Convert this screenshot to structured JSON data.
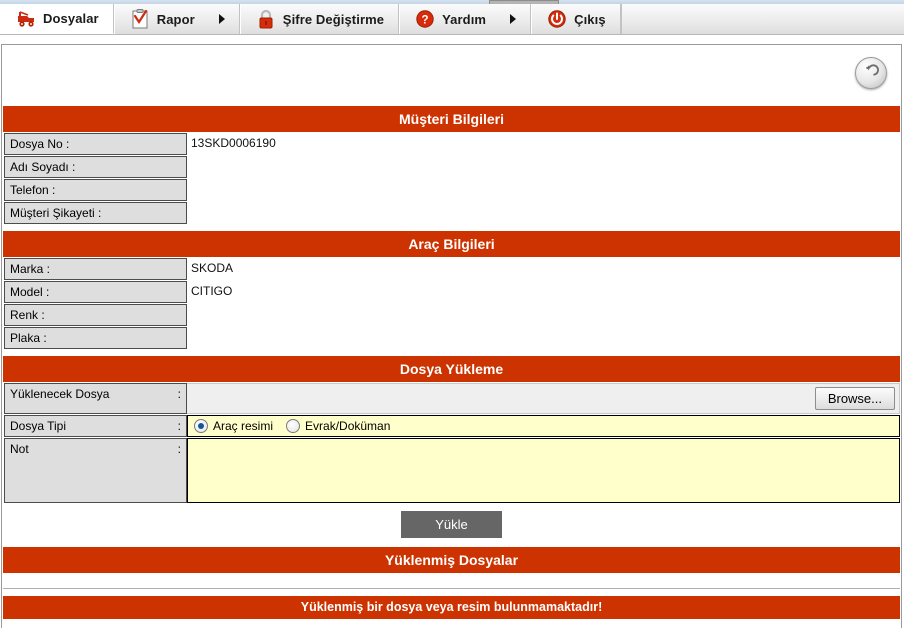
{
  "menu": {
    "items": [
      {
        "label": "Dosyalar",
        "icon": "tow-truck-icon",
        "active": true,
        "has_arrow": false
      },
      {
        "label": "Rapor",
        "icon": "clipboard-check-icon",
        "active": false,
        "has_arrow": true
      },
      {
        "label": "Şifre Değiştirme",
        "icon": "padlock-icon",
        "active": false,
        "has_arrow": false
      },
      {
        "label": "Yardım",
        "icon": "question-circle-icon",
        "active": false,
        "has_arrow": true
      },
      {
        "label": "Çıkış",
        "icon": "power-icon",
        "active": false,
        "has_arrow": false
      }
    ]
  },
  "toolbar": {
    "back_icon": "back-arrow-icon"
  },
  "sections": {
    "customer": {
      "title": "Müşteri Bilgileri",
      "rows": [
        {
          "label": "Dosya No :",
          "value": "13SKD0006190"
        },
        {
          "label": "Adı Soyadı :",
          "value": ""
        },
        {
          "label": "Telefon :",
          "value": ""
        },
        {
          "label": "Müşteri Şikayeti :",
          "value": ""
        }
      ]
    },
    "vehicle": {
      "title": "Araç Bilgileri",
      "rows": [
        {
          "label": "Marka :",
          "value": "SKODA"
        },
        {
          "label": "Model :",
          "value": "CITIGO"
        },
        {
          "label": "Renk :",
          "value": ""
        },
        {
          "label": "Plaka :",
          "value": ""
        }
      ]
    },
    "upload": {
      "title": "Dosya Yükleme",
      "file_label": "Yüklenecek Dosya",
      "file_colon": ":",
      "file_value": "",
      "browse_label": "Browse...",
      "type_label": "Dosya Tipi",
      "type_colon": ":",
      "type_options": [
        {
          "label": "Araç resimi",
          "selected": true
        },
        {
          "label": "Evrak/Doküman",
          "selected": false
        }
      ],
      "note_label": "Not",
      "note_colon": ":",
      "note_value": "",
      "submit_label": "Yükle"
    },
    "uploaded": {
      "title": "Yüklenmiş Dosyalar",
      "empty_message": "Yüklenmiş bir dosya veya resim bulunmamaktadır!"
    }
  },
  "colors": {
    "brand_red": "#cc3300",
    "label_gray": "#dedede",
    "field_yellow": "#ffffcc",
    "button_gray": "#666666"
  }
}
